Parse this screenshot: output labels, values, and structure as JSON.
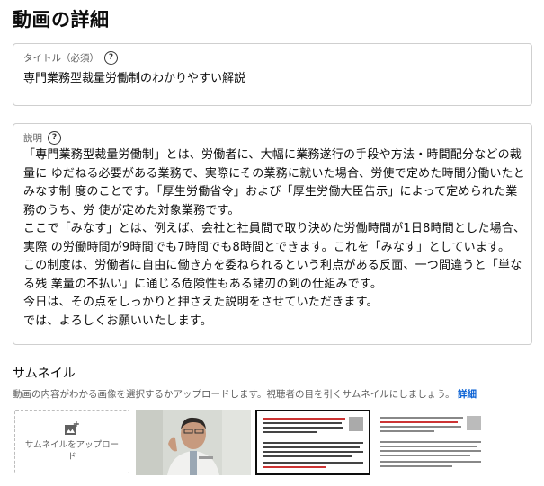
{
  "page": {
    "title": "動画の詳細"
  },
  "title_field": {
    "label": "タイトル（必須）",
    "value": "専門業務型裁量労働制のわかりやすい解説"
  },
  "description_field": {
    "label": "説明",
    "lines": [
      "「専門業務型裁量労働制」とは、労働者に、大幅に業務遂行の手段や方法・時間配分などの裁量に ゆだねる必要がある業務で、実際にその業務に就いた場合、労使で定めた時間分働いたとみなす制 度のことです。「厚生労働省令」および「厚生労働大臣告示」によって定められた業務のうち、労 使が定めた対象業務です。",
      "ここで「みなす」とは、例えば、会社と社員間で取り決めた労働時間が1日8時間とした場合、実際 の労働時間が9時間でも7時間でも8時間とできます。これを「みなす」としています。",
      "この制度は、労働者に自由に働き方を委ねられるという利点がある反面、一つ間違うと「単なる残 業量の不払い」に通じる危険性もある諸刃の剣の仕組みです。",
      "今日は、その点をしっかりと押さえた説明をさせていただきます。",
      "では、よろしくお願いいたします。"
    ]
  },
  "thumbnail": {
    "heading": "サムネイル",
    "description": "動画の内容がわかる画像を選択するかアップロードします。視聴者の目を引くサムネイルにしましょう。",
    "link": "詳細",
    "upload_label": "サムネイルをアップロード",
    "selected_index": 1
  },
  "colors": {
    "link": "#065fd4",
    "border": "#cfcfcf",
    "secondary_text": "#606060"
  }
}
